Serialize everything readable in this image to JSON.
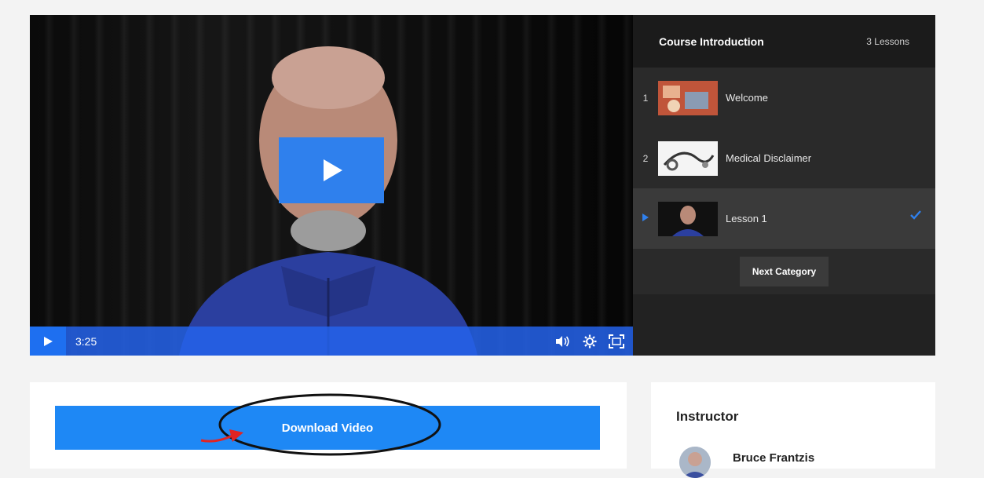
{
  "video": {
    "time": "3:25"
  },
  "playlist": {
    "title": "Course Introduction",
    "count": "3 Lessons",
    "lessons": [
      {
        "num": "1",
        "label": "Welcome"
      },
      {
        "num": "2",
        "label": "Medical Disclaimer"
      },
      {
        "num": "",
        "label": "Lesson 1"
      }
    ],
    "next_label": "Next Category"
  },
  "download": {
    "label": "Download Video"
  },
  "instructor": {
    "heading": "Instructor",
    "name": "Bruce Frantzis"
  },
  "colors": {
    "accent": "#1e88f5",
    "controls": "#2563eb",
    "playlist_bg": "#222222"
  }
}
